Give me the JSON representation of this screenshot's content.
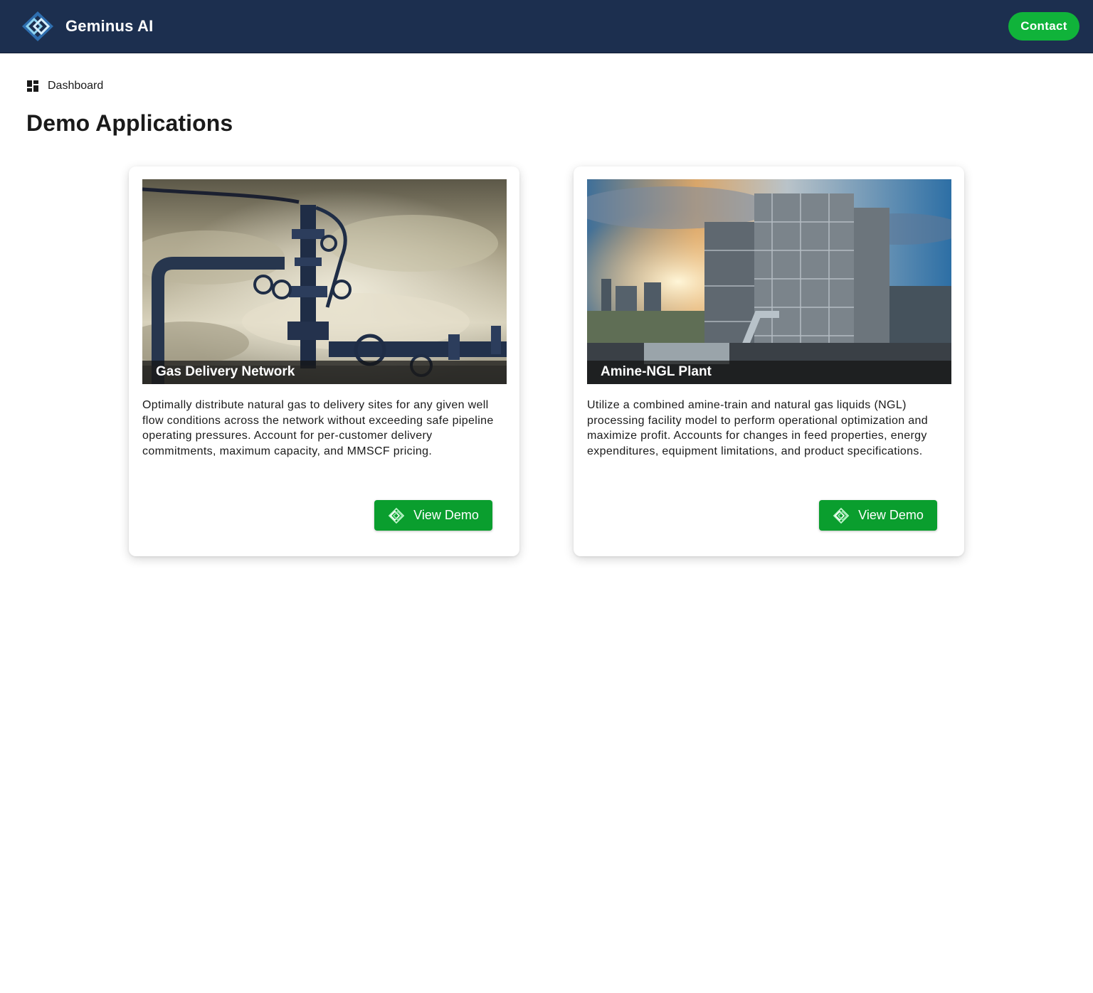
{
  "header": {
    "brand_name": "Geminus AI",
    "logo_icon": "geminus-diamond-logo",
    "contact_label": "Contact",
    "colors": {
      "background": "#1c2f4f",
      "accent": "#10b33a"
    }
  },
  "breadcrumb": {
    "icon": "dashboard-grid-icon",
    "label": "Dashboard"
  },
  "page": {
    "title": "Demo Applications"
  },
  "cards": [
    {
      "title": "Gas Delivery Network",
      "image": "gas wellhead pipeline photo",
      "description": "Optimally distribute natural gas to delivery sites for any given well flow conditions across the network without exceeding safe pipeline operating pressures. Account for per-customer delivery commitments, maximum capacity, and MMSCF pricing.",
      "button_label": "View Demo",
      "button_icon": "geminus-diamond-icon"
    },
    {
      "title": "Amine-NGL Plant",
      "image": "processing plant at sunset photo",
      "description": "Utilize a combined amine-train and natural gas liquids (NGL) processing facility model to perform operational optimization and maximize profit. Accounts for changes in feed properties, energy expenditures, equipment limitations, and product specifications.",
      "button_label": "View Demo",
      "button_icon": "geminus-diamond-icon"
    }
  ],
  "colors": {
    "button": "#0a9e2e"
  }
}
